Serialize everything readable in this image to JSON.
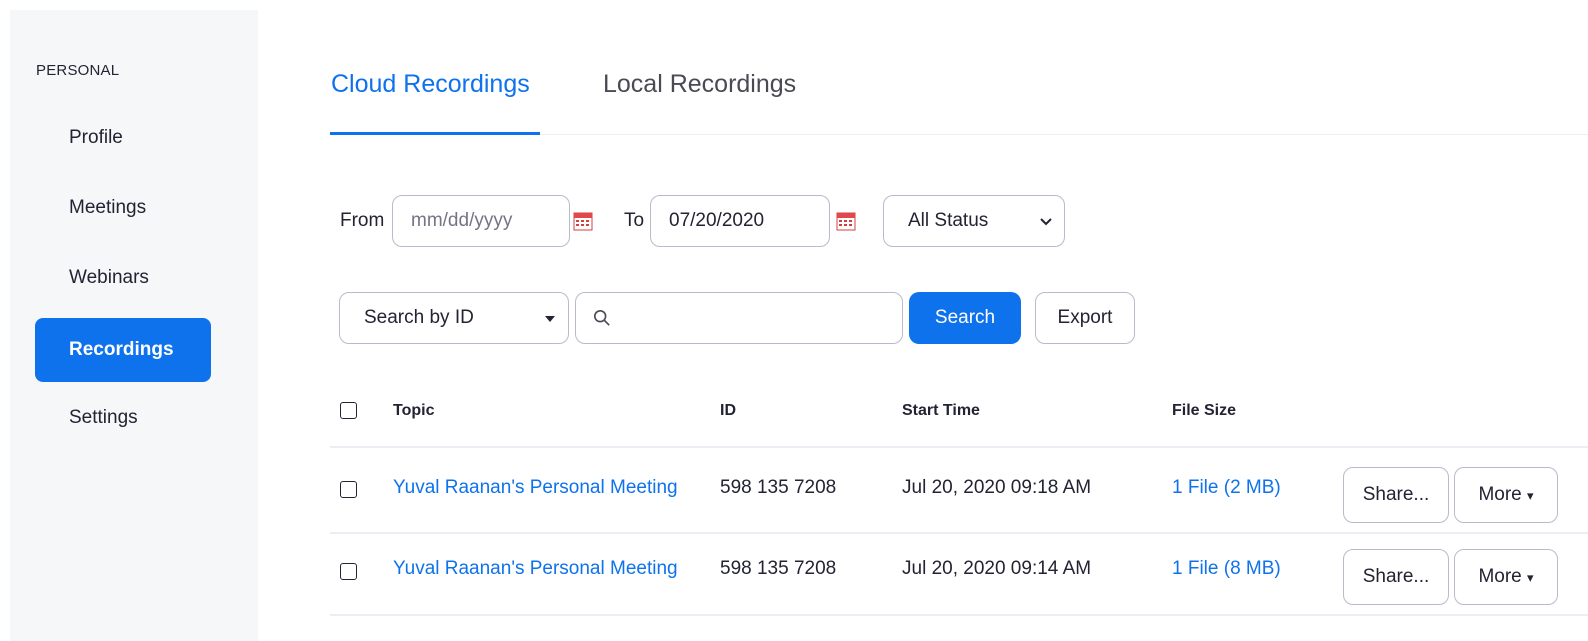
{
  "sidebar": {
    "section_label": "PERSONAL",
    "items": [
      {
        "label": "Profile"
      },
      {
        "label": "Meetings"
      },
      {
        "label": "Webinars"
      },
      {
        "label": "Recordings",
        "active": true
      },
      {
        "label": "Settings"
      }
    ]
  },
  "tabs": [
    {
      "label": "Cloud Recordings",
      "active": true
    },
    {
      "label": "Local Recordings"
    }
  ],
  "filters": {
    "from_label": "From",
    "from_placeholder": "mm/dd/yyyy",
    "to_label": "To",
    "to_value": "07/20/2020",
    "status_value": "All Status",
    "search_by_value": "Search by ID",
    "search_placeholder": "",
    "search_button": "Search",
    "export_button": "Export"
  },
  "table": {
    "headers": [
      "Topic",
      "ID",
      "Start Time",
      "File Size"
    ],
    "rows": [
      {
        "topic": "Yuval Raanan's Personal Meeting",
        "id": "598 135 7208",
        "start_time": "Jul 20, 2020 09:18 AM",
        "file_size": "1 File (2 MB)",
        "share": "Share...",
        "more": "More"
      },
      {
        "topic": "Yuval Raanan's Personal Meeting",
        "id": "598 135 7208",
        "start_time": "Jul 20, 2020 09:14 AM",
        "file_size": "1 File (8 MB)",
        "share": "Share...",
        "more": "More"
      }
    ]
  },
  "colors": {
    "accent": "#0e72ed",
    "sidebar_bg": "#f6f7f9",
    "calendar_icon": "#e0484b"
  }
}
